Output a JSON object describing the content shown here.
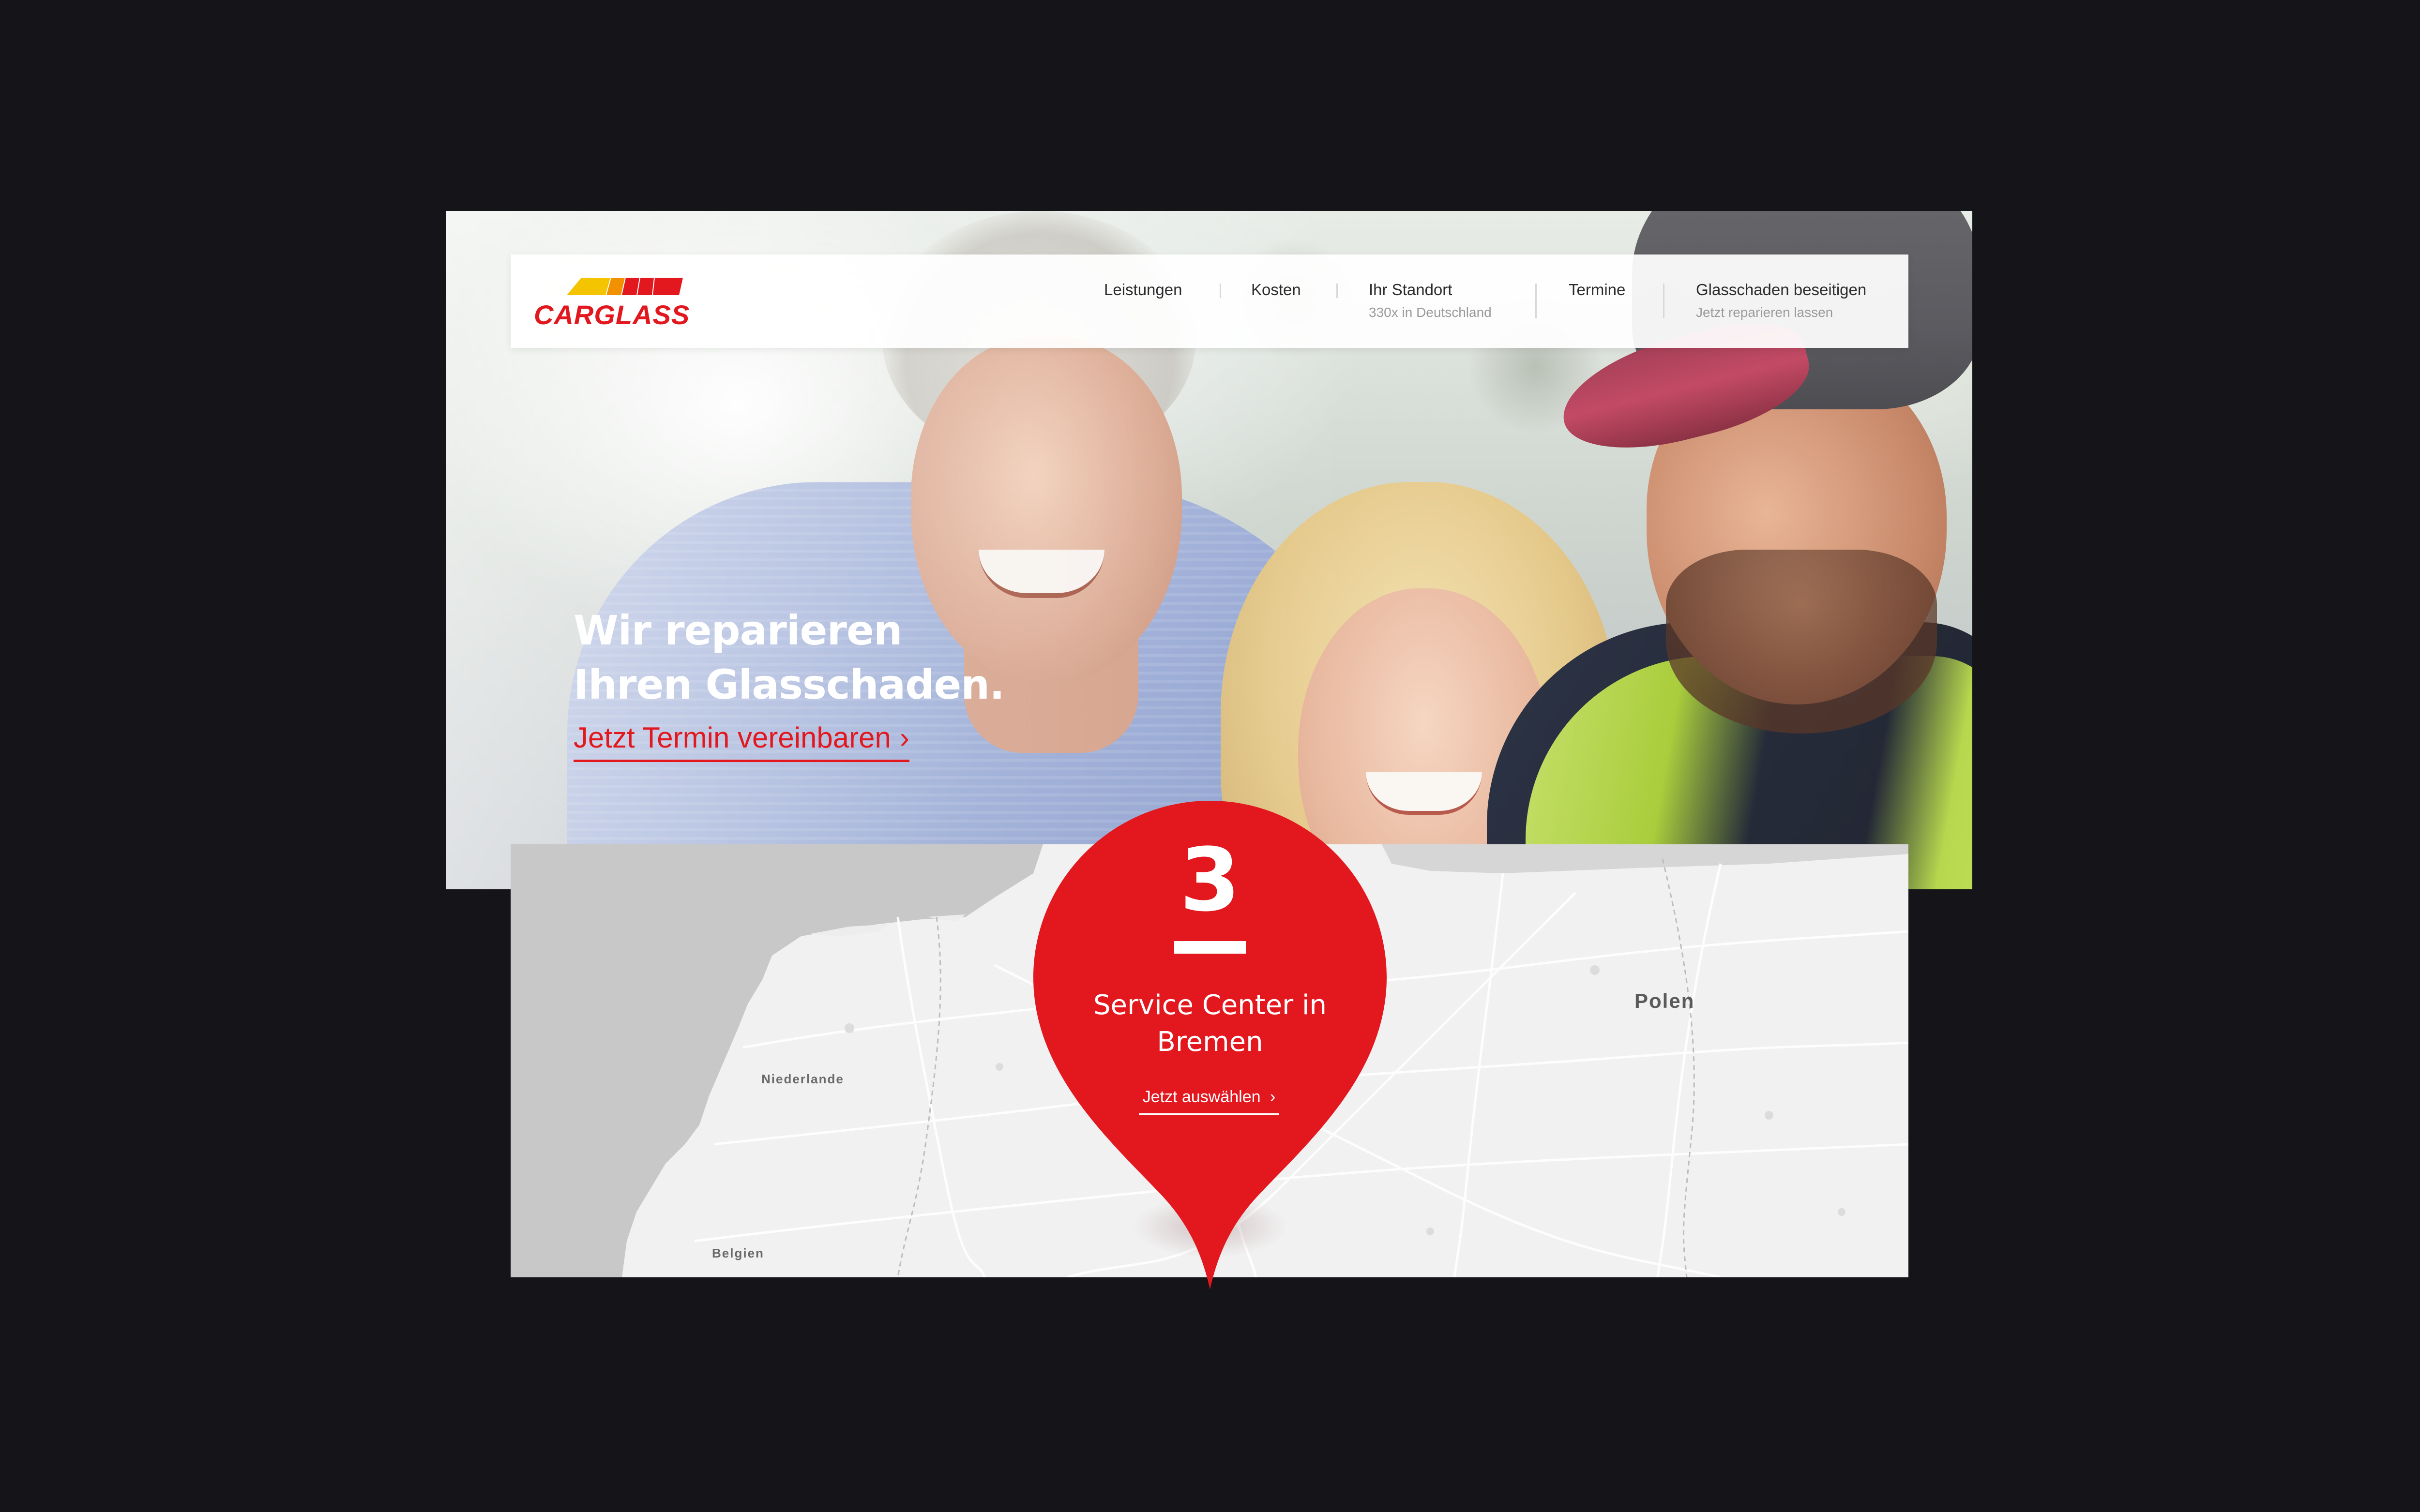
{
  "brand": {
    "name": "CARGLASS",
    "color": "#e3181f",
    "logo_stripe_colors": [
      "#f5c400",
      "#f29100",
      "#e3181f",
      "#e3181f"
    ]
  },
  "nav": {
    "items": [
      {
        "label": "Leistungen",
        "sub": ""
      },
      {
        "label": "Kosten",
        "sub": ""
      },
      {
        "label": "Ihr Standort",
        "sub": "330x in Deutschland"
      },
      {
        "label": "Termine",
        "sub": ""
      },
      {
        "label": "Glasschaden beseitigen",
        "sub": "Jetzt reparieren lassen"
      }
    ]
  },
  "hero": {
    "headline_line1": "Wir reparieren",
    "headline_line2": "Ihren Glasschaden.",
    "cta_label": "Jetzt Termin vereinbaren",
    "cta_icon": "chevron-right-icon"
  },
  "map": {
    "labels": {
      "niederlande": "Niederlande",
      "polen": "Polen",
      "belgien": "Belgien"
    }
  },
  "service_pin": {
    "count": "3",
    "title_line1": "Service Center in",
    "title_line2": "Bremen",
    "link_label": "Jetzt auswählen",
    "link_icon": "chevron-right-icon",
    "color": "#e3181f"
  },
  "colors": {
    "background": "#141419",
    "accent": "#e3181f"
  }
}
